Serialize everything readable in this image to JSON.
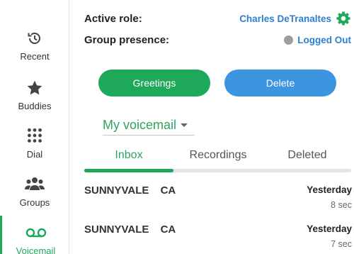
{
  "nav": {
    "items": [
      {
        "label": "Recent",
        "icon": "clock-history-icon"
      },
      {
        "label": "Buddies",
        "icon": "star-icon"
      },
      {
        "label": "Dial",
        "icon": "dialpad-icon"
      },
      {
        "label": "Groups",
        "icon": "group-icon"
      },
      {
        "label": "Voicemail",
        "icon": "voicemail-icon"
      }
    ],
    "active": "Voicemail"
  },
  "header": {
    "role_label": "Active role:",
    "user_name": "Charles DeTranaltes",
    "presence_label": "Group presence:",
    "presence_status": "Logged Out",
    "presence_color": "#9e9e9e"
  },
  "actions": {
    "greetings_label": "Greetings",
    "delete_label": "Delete"
  },
  "mailbox": {
    "selected": "My voicemail"
  },
  "tabs": {
    "items": [
      "Inbox",
      "Recordings",
      "Deleted"
    ],
    "active": "Inbox"
  },
  "messages": [
    {
      "caller": "SUNNYVALE CA",
      "date": "Yesterday",
      "duration": "8 sec"
    },
    {
      "caller": "SUNNYVALE CA",
      "date": "Yesterday",
      "duration": "7 sec"
    }
  ],
  "colors": {
    "accent_green": "#1ea85a",
    "accent_blue": "#3b95df",
    "link_blue": "#2f7fd1"
  }
}
